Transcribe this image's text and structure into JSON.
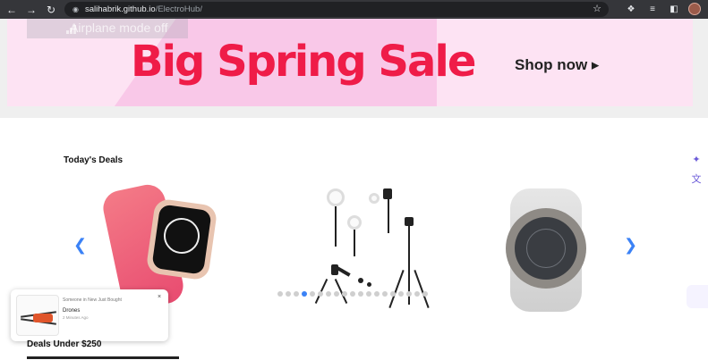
{
  "browser": {
    "url_host": "salihabrik.github.io",
    "url_path": "/ElectroHub/",
    "back_icon": "arrow-left-icon",
    "forward_icon": "arrow-right-icon",
    "reload_icon": "reload-icon"
  },
  "banner": {
    "title": "Big Spring Sale",
    "cta": "Shop now ▸",
    "ghost_text": "Airplane mode off",
    "title_color": "#ef1c48"
  },
  "deals": {
    "title": "Today's Deals",
    "dots_count": 19,
    "active_dot": 3
  },
  "popup": {
    "line1": "Someone in New Just Bought",
    "product": "Drones",
    "time": "2 Minutes Ago",
    "close": "×"
  },
  "section2": {
    "title": "Deals Under $250"
  },
  "colors": {
    "accent": "#3b82f6",
    "banner_bg": "#fde3f3"
  }
}
